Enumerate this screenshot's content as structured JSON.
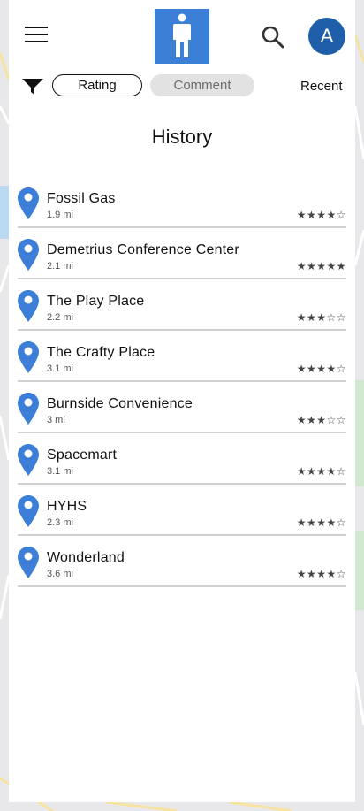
{
  "header": {
    "menu_icon": "hamburger-menu-icon",
    "logo_icon": "person-restroom-icon",
    "search_icon": "search-icon",
    "avatar_initial": "A"
  },
  "filters": {
    "filter_icon": "funnel-filter-icon",
    "chips": [
      "Rating",
      "Comment"
    ],
    "sort_label": "Recent"
  },
  "page_title": "History",
  "history": [
    {
      "name": "Fossil Gas",
      "distance": "1.9 mi",
      "stars": "★★★★☆"
    },
    {
      "name": "Demetrius Conference Center",
      "distance": "2.1 mi",
      "stars": "★★★★★"
    },
    {
      "name": "The Play Place",
      "distance": "2.2 mi",
      "stars": "★★★☆☆"
    },
    {
      "name": "The Crafty Place",
      "distance": "3.1 mi",
      "stars": "★★★★☆"
    },
    {
      "name": "Burnside Convenience",
      "distance": "3 mi",
      "stars": "★★★☆☆"
    },
    {
      "name": "Spacemart",
      "distance": "3.1 mi",
      "stars": "★★★★☆"
    },
    {
      "name": "HYHS",
      "distance": "2.3 mi",
      "stars": "★★★★☆"
    },
    {
      "name": "Wonderland",
      "distance": "3.6 mi",
      "stars": "★★★★☆"
    }
  ],
  "colors": {
    "brand_blue": "#3b7fd6",
    "avatar_blue": "#1f5ea8",
    "pin_blue": "#3d7fd8"
  }
}
